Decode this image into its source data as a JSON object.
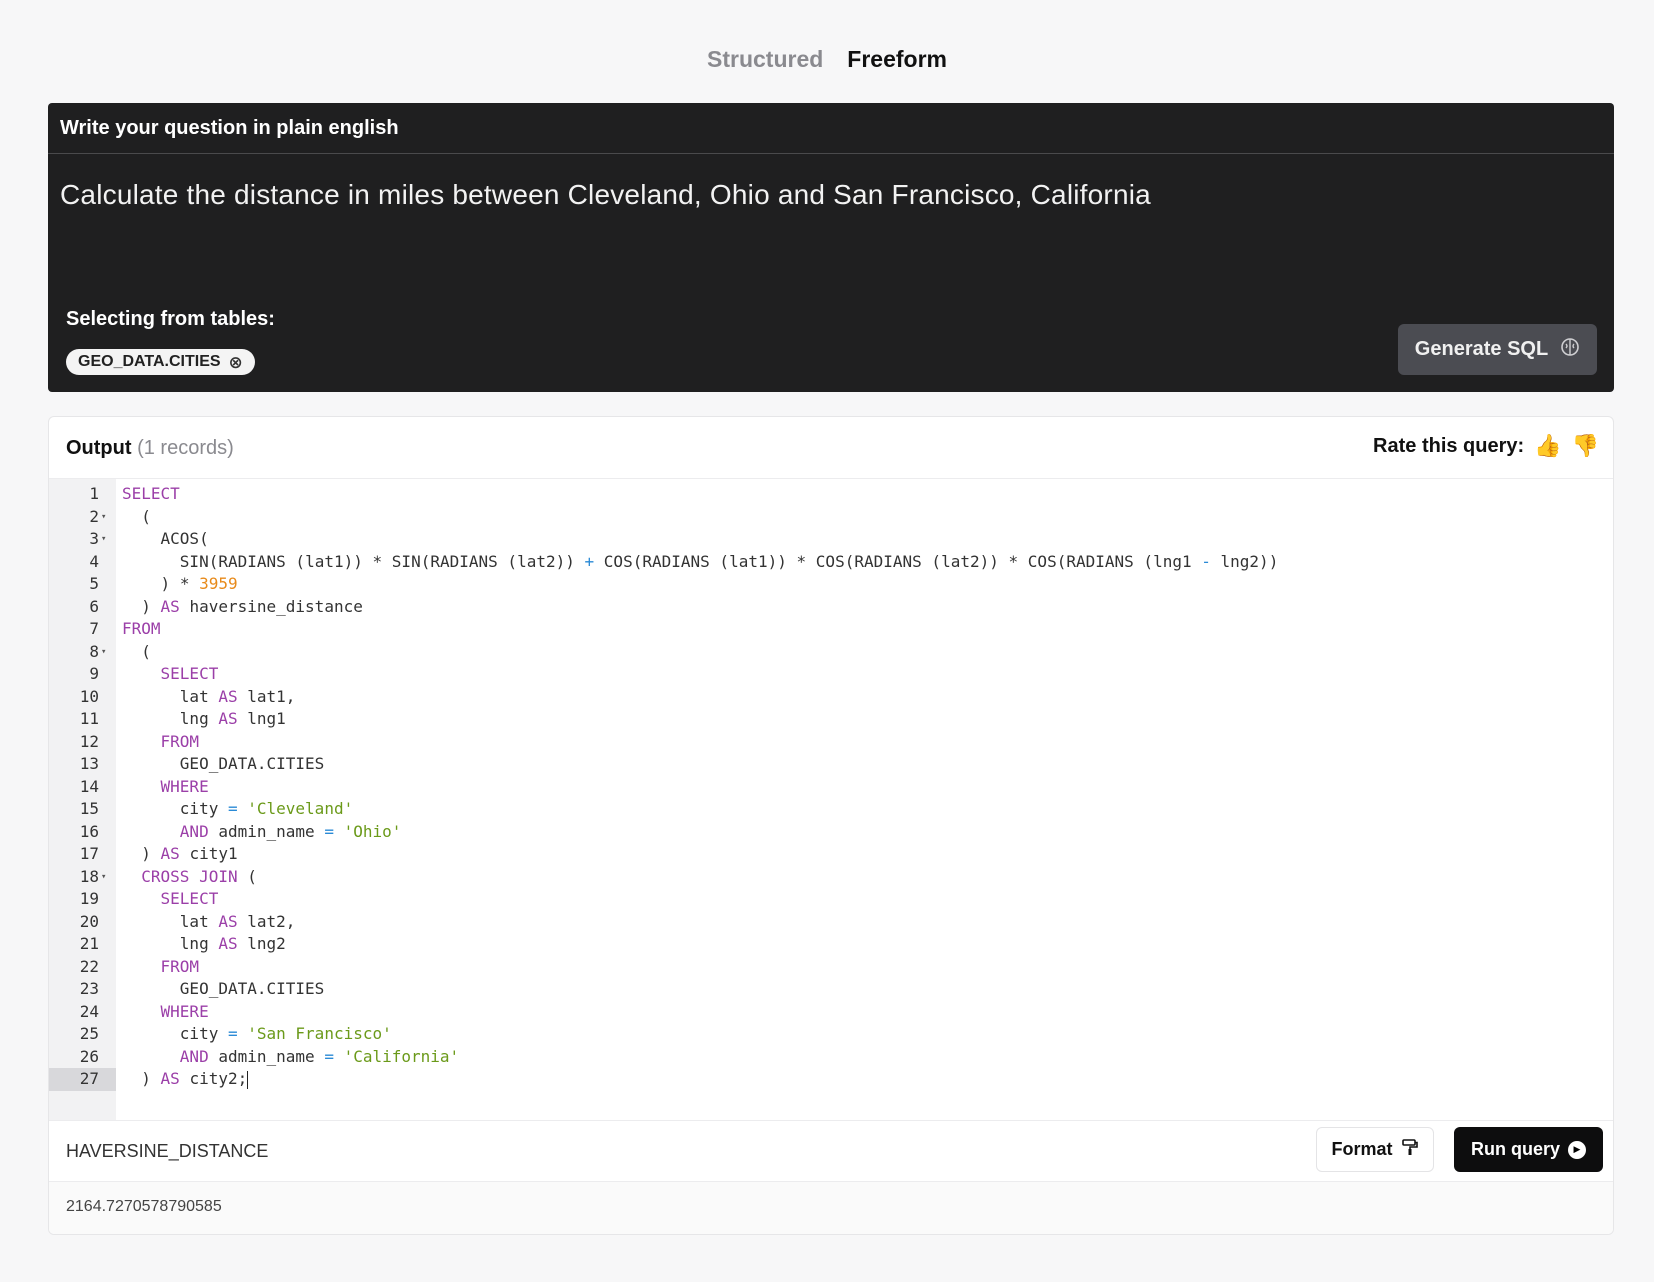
{
  "mode_tabs": [
    {
      "label": "Structured",
      "active": false
    },
    {
      "label": "Freeform",
      "active": true
    }
  ],
  "question_panel": {
    "header": "Write your question in plain english",
    "question": "Calculate the distance in miles between Cleveland, Ohio and San Francisco, California",
    "tables_label": "Selecting from tables:",
    "tables": [
      "GEO_DATA.CITIES"
    ],
    "chip_remove_icon": "circle-x-icon",
    "generate_label": "Generate SQL",
    "generate_icon": "brain-icon"
  },
  "output": {
    "title": "Output",
    "count": "(1 records)",
    "rate_label": "Rate this query:",
    "thumbs_up_icon": "thumbs-up-icon",
    "thumbs_down_icon": "thumbs-down-icon",
    "format_label": "Format",
    "format_icon": "paint-roller-icon",
    "run_label": "Run query",
    "run_icon": "play-circle-icon",
    "current_line": 27,
    "foldable_lines": [
      2,
      3,
      8,
      18
    ],
    "code_lines": [
      "SELECT",
      "  (",
      "    ACOS(",
      "      SIN(RADIANS (lat1)) * SIN(RADIANS (lat2)) + COS(RADIANS (lat1)) * COS(RADIANS (lat2)) * COS(RADIANS (lng1 - lng2))",
      "    ) * 3959",
      "  ) AS haversine_distance",
      "FROM",
      "  (",
      "    SELECT",
      "      lat AS lat1,",
      "      lng AS lng1",
      "    FROM",
      "      GEO_DATA.CITIES",
      "    WHERE",
      "      city = 'Cleveland'",
      "      AND admin_name = 'Ohio'",
      "  ) AS city1",
      "  CROSS JOIN (",
      "    SELECT",
      "      lat AS lat2,",
      "      lng AS lng2",
      "    FROM",
      "      GEO_DATA.CITIES",
      "    WHERE",
      "      city = 'San Francisco'",
      "      AND admin_name = 'California'",
      "  ) AS city2;"
    ],
    "result_columns": [
      "HAVERSINE_DISTANCE"
    ],
    "result_rows": [
      [
        "2164.7270578790585"
      ]
    ]
  },
  "colors": {
    "keyword": "#9b3fa8",
    "number": "#e88a1a",
    "string": "#6b9a1a",
    "operator": "#2a8ad6",
    "panel_dark": "#1f1f20",
    "run_button": "#0d0d0e"
  }
}
